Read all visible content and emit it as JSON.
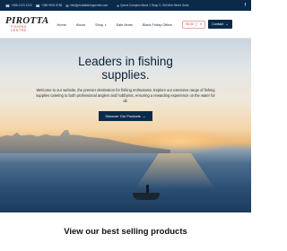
{
  "topbar": {
    "phone1": "+356 2123 1223",
    "phone2": "+356 9902 8756",
    "email": "info@pirottafishingcentre.com",
    "address": "Qorrot Complex Block 1 Shop 3, Old Mint Street Gzira",
    "social_icon": "facebook-icon"
  },
  "header": {
    "logo_text": "PIROTTA",
    "logo_sub": "FISHING CENTRE",
    "nav": [
      {
        "label": "Home"
      },
      {
        "label": "About"
      },
      {
        "label": "Shop"
      },
      {
        "label": "Sale Items"
      },
      {
        "label": "Black Friday Offers"
      }
    ],
    "cart_value": "€0.00",
    "cart_count": "0",
    "contact_label": "Contact"
  },
  "hero": {
    "title": "Leaders in fishing supplies.",
    "text": "Welcome to our website, the premier destination for fishing enthusiasts. Explore our extensive range of fishing supplies catering to both professional anglers and hobbyists, ensuring a rewarding experience on the water for all.",
    "cta_label": "Discover Our Products"
  },
  "section": {
    "title": "View our best selling products"
  },
  "colors": {
    "navy": "#0b2a4a",
    "accent_red": "#c0392b"
  }
}
